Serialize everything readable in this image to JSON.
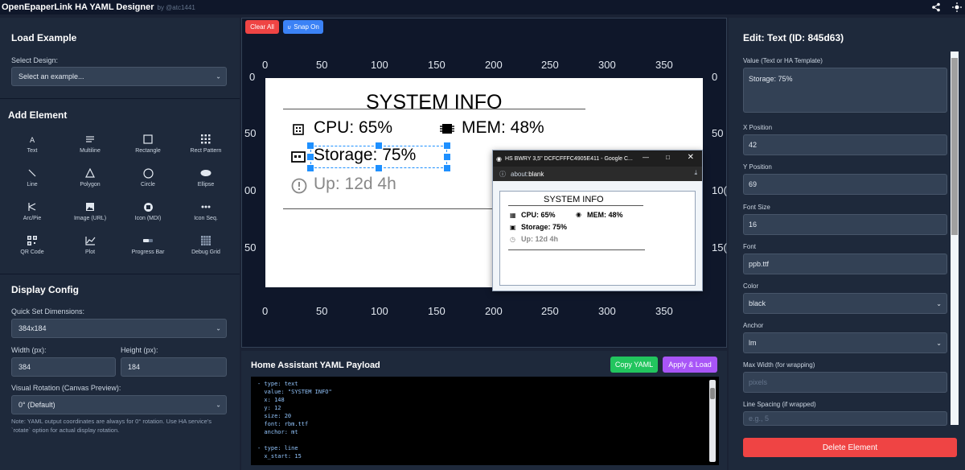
{
  "app": {
    "title": "OpenEpaperLink HA YAML Designer",
    "by": "by @atc1441"
  },
  "left": {
    "load_example": "Load Example",
    "select_design_label": "Select Design:",
    "select_design_value": "Select an example...",
    "add_element": "Add Element",
    "tools": [
      {
        "label": "Text",
        "icon": "text-icon"
      },
      {
        "label": "Multiline",
        "icon": "multiline-icon"
      },
      {
        "label": "Rectangle",
        "icon": "rectangle-icon"
      },
      {
        "label": "Rect Pattern",
        "icon": "rect-pattern-icon"
      },
      {
        "label": "Line",
        "icon": "line-icon"
      },
      {
        "label": "Polygon",
        "icon": "polygon-icon"
      },
      {
        "label": "Circle",
        "icon": "circle-icon"
      },
      {
        "label": "Ellipse",
        "icon": "ellipse-icon"
      },
      {
        "label": "Arc/Pie",
        "icon": "arc-pie-icon"
      },
      {
        "label": "Image (URL)",
        "icon": "image-icon"
      },
      {
        "label": "Icon (MDI)",
        "icon": "mdi-icon"
      },
      {
        "label": "Icon Seq.",
        "icon": "icon-seq-icon"
      },
      {
        "label": "QR Code",
        "icon": "qr-code-icon"
      },
      {
        "label": "Plot",
        "icon": "plot-icon"
      },
      {
        "label": "Progress Bar",
        "icon": "progress-bar-icon"
      },
      {
        "label": "Debug Grid",
        "icon": "debug-grid-icon"
      }
    ],
    "display_config": "Display Config",
    "quick_set_label": "Quick Set Dimensions:",
    "quick_set_value": "384x184",
    "width_label": "Width (px):",
    "width_value": "384",
    "height_label": "Height (px):",
    "height_value": "184",
    "rotation_label": "Visual Rotation (Canvas Preview):",
    "rotation_value": "0° (Default)",
    "note": "Note: YAML output coordinates are always for 0° rotation. Use HA service's `rotate` option for actual display rotation."
  },
  "toolbar": {
    "clear_all": "Clear All",
    "snap_on": "Snap On"
  },
  "rulers": {
    "top": [
      "0",
      "50",
      "100",
      "150",
      "200",
      "250",
      "300",
      "350"
    ],
    "bottom": [
      "0",
      "50",
      "100",
      "150",
      "200",
      "250",
      "300",
      "350"
    ],
    "left": [
      "0",
      "50",
      "00",
      "50"
    ],
    "right": [
      "0",
      "50",
      "10(",
      "15("
    ]
  },
  "canvas": {
    "title": "SYSTEM INFO",
    "cpu": "CPU: 65%",
    "mem": "MEM: 48%",
    "storage": "Storage: 75%",
    "uptime": "Up: 12d 4h"
  },
  "popup": {
    "window_title": "HS BWRY 3,5\" DCFCFFFC4905E411 - Google C...",
    "address_prefix": "about:",
    "address_bold": "blank",
    "title": "SYSTEM INFO",
    "cpu": "CPU: 65%",
    "mem": "MEM: 48%",
    "storage": "Storage: 75%",
    "uptime": "Up: 12d 4h"
  },
  "yaml": {
    "title": "Home Assistant YAML Payload",
    "copy": "Copy YAML",
    "apply": "Apply & Load",
    "lines": [
      "- type: text",
      "  value: \"SYSTEM INFO\"",
      "  x: 148",
      "  y: 12",
      "  size: 20",
      "  font: rbm.ttf",
      "  anchor: mt",
      "",
      "- type: line",
      "  x_start: 15"
    ]
  },
  "right": {
    "title": "Edit: Text (ID: 845d63)",
    "value_label": "Value (Text or HA Template)",
    "value": "Storage: 75%",
    "x_label": "X Position",
    "x_value": "42",
    "y_label": "Y Position",
    "y_value": "69",
    "size_label": "Font Size",
    "size_value": "16",
    "font_label": "Font",
    "font_value": "ppb.ttf",
    "color_label": "Color",
    "color_value": "black",
    "anchor_label": "Anchor",
    "anchor_value": "lm",
    "max_width_label": "Max Width (for wrapping)",
    "max_width_placeholder": "pixels",
    "line_spacing_label": "Line Spacing (if wrapped)",
    "line_spacing_placeholder": "e.g., 5",
    "delete": "Delete Element"
  },
  "colors": {
    "bg": "#1a2234",
    "panel": "#1e293b",
    "danger": "#ef4444",
    "primary": "#3b82f6",
    "success": "#22c55e",
    "purple": "#a855f7"
  }
}
